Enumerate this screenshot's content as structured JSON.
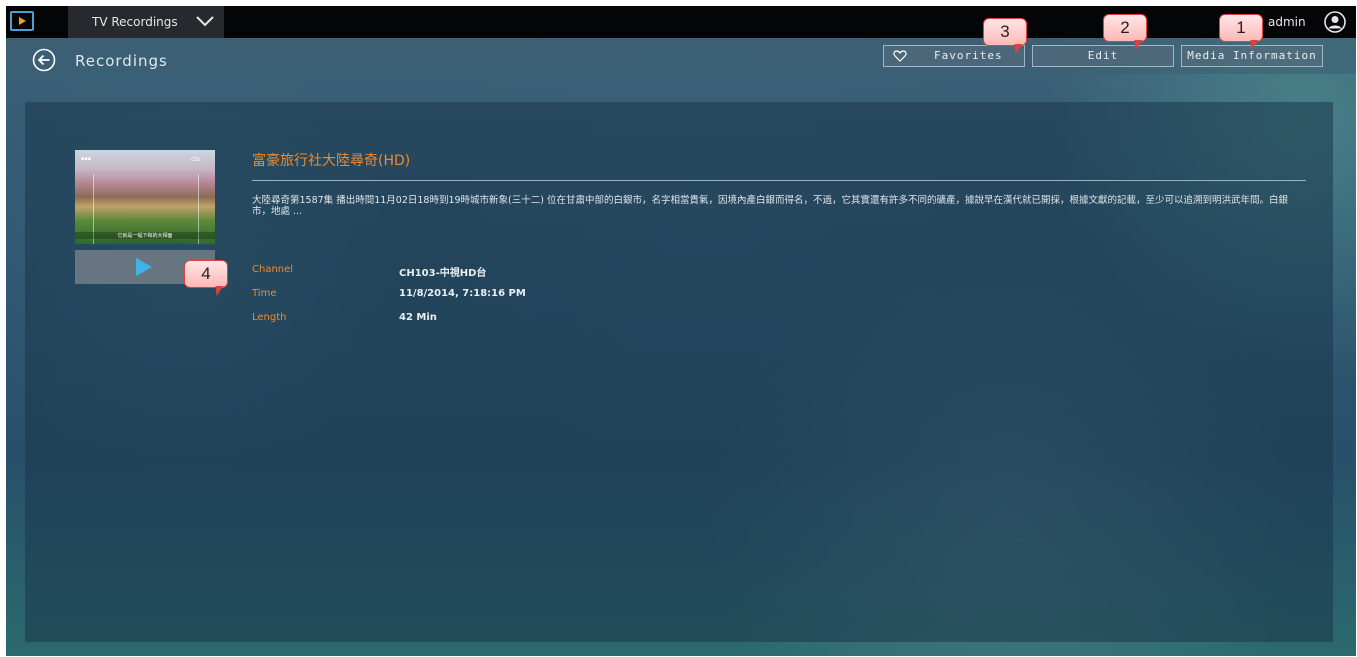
{
  "topbar": {
    "app_dropdown_label": "TV Recordings",
    "user_name": "admin"
  },
  "header": {
    "title": "Recordings",
    "buttons": {
      "favorites": "Favorites",
      "edit": "Edit",
      "media_information": "Media Information"
    }
  },
  "recording": {
    "thumbnail_caption": "它就是一幅下和的大相面",
    "thumbnail_channel_logo": "cts",
    "title": "富豪旅行社大陸尋奇(HD)",
    "description": "大陸尋奇第1587集 播出時間11月02日18時到19時城市新象(三十二) 位在甘肅中部的白銀市，名字相當貴氣，因境內產白銀而得名，不過，它其實還有許多不同的礦產，據說早在漢代就已開採，根據文獻的記載，至少可以追溯到明洪武年間。白銀市，地處 ...",
    "fields": {
      "channel_label": "Channel",
      "channel_value": "CH103-中視HD台",
      "time_label": "Time",
      "time_value": "11/8/2014, 7:18:16 PM",
      "length_label": "Length",
      "length_value": "42 Min"
    }
  },
  "callouts": [
    "1",
    "2",
    "3",
    "4"
  ],
  "colors": {
    "accent_orange": "#f08a2a",
    "play_blue": "#3eb4e6",
    "topbar_black": "#040506"
  }
}
